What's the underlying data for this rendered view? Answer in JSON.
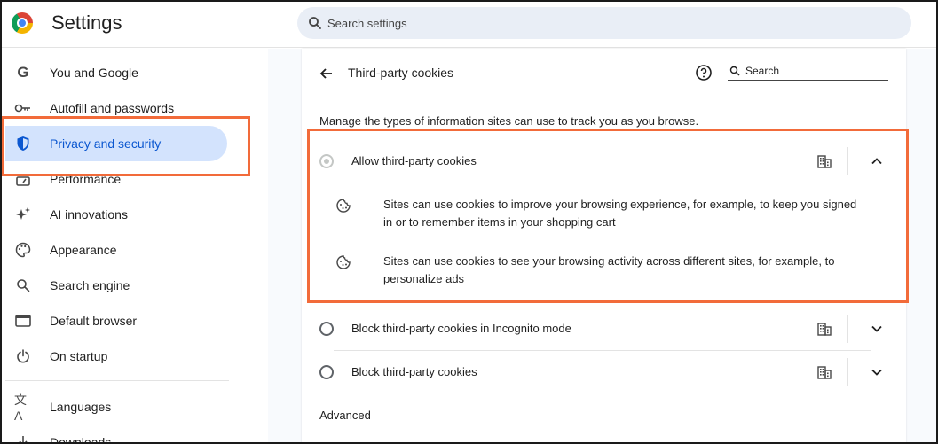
{
  "header": {
    "title": "Settings",
    "search_placeholder": "Search settings"
  },
  "sidebar": {
    "items": [
      {
        "label": "You and Google",
        "icon": "google-g-icon"
      },
      {
        "label": "Autofill and passwords",
        "icon": "key-icon"
      },
      {
        "label": "Privacy and security",
        "icon": "shield-icon",
        "active": true
      },
      {
        "label": "Performance",
        "icon": "speedometer-icon"
      },
      {
        "label": "AI innovations",
        "icon": "sparkle-icon"
      },
      {
        "label": "Appearance",
        "icon": "palette-icon"
      },
      {
        "label": "Search engine",
        "icon": "search-icon"
      },
      {
        "label": "Default browser",
        "icon": "browser-window-icon"
      },
      {
        "label": "On startup",
        "icon": "power-icon"
      },
      {
        "label": "Languages",
        "icon": "translate-icon"
      },
      {
        "label": "Downloads",
        "icon": "download-icon"
      }
    ]
  },
  "main": {
    "page_title": "Third-party cookies",
    "sub_search_placeholder": "Search",
    "description": "Manage the types of information sites can use to track you as you browse.",
    "options": [
      {
        "label": "Allow third-party cookies",
        "expanded": true,
        "disabled": true
      },
      {
        "label": "Block third-party cookies in Incognito mode",
        "expanded": false
      },
      {
        "label": "Block third-party cookies",
        "expanded": false
      }
    ],
    "details": [
      "Sites can use cookies to improve your browsing experience, for example, to keep you signed in or to remember items in your shopping cart",
      "Sites can use cookies to see your browsing activity across different sites, for example, to personalize ads"
    ],
    "advanced_label": "Advanced"
  },
  "colors": {
    "accent": "#0b57d0",
    "active_bg": "#d3e3fd",
    "annotation": "#f26b3a",
    "search_bg": "#e9eef6"
  }
}
